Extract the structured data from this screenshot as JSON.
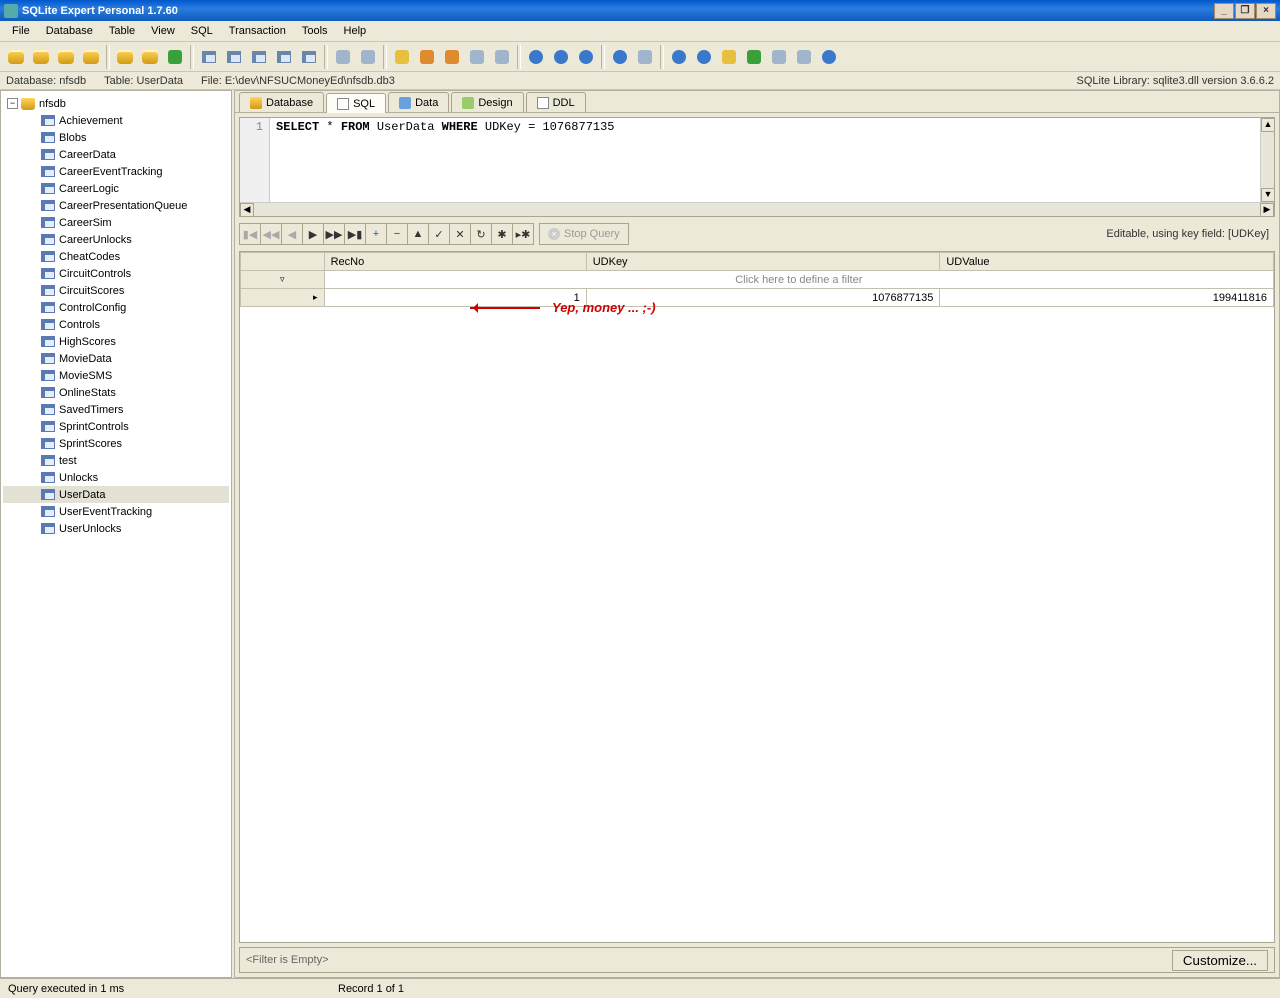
{
  "window": {
    "title": "SQLite Expert Personal 1.7.60"
  },
  "menu": {
    "file": "File",
    "database": "Database",
    "table": "Table",
    "view": "View",
    "sql": "SQL",
    "transaction": "Transaction",
    "tools": "Tools",
    "help": "Help"
  },
  "info": {
    "database_label": "Database: nfsdb",
    "table_label": "Table: UserData",
    "file_label": "File: E:\\dev\\NFSUCMoneyEd\\nfsdb.db3",
    "library": "SQLite Library: sqlite3.dll version 3.6.6.2"
  },
  "tree": {
    "root": "nfsdb",
    "items": [
      "Achievement",
      "Blobs",
      "CareerData",
      "CareerEventTracking",
      "CareerLogic",
      "CareerPresentationQueue",
      "CareerSim",
      "CareerUnlocks",
      "CheatCodes",
      "CircuitControls",
      "CircuitScores",
      "ControlConfig",
      "Controls",
      "HighScores",
      "MovieData",
      "MovieSMS",
      "OnlineStats",
      "SavedTimers",
      "SprintControls",
      "SprintScores",
      "test",
      "Unlocks",
      "UserData",
      "UserEventTracking",
      "UserUnlocks"
    ],
    "selected": "UserData"
  },
  "tabs": {
    "database": "Database",
    "sql": "SQL",
    "data": "Data",
    "design": "Design",
    "ddl": "DDL"
  },
  "sql": {
    "line_no": "1",
    "code_kw1": "SELECT",
    "code_mid": " * ",
    "code_kw2": "FROM",
    "code_tbl": " UserData ",
    "code_kw3": "WHERE",
    "code_rest": " UDKey = 1076877135"
  },
  "nav": {
    "stop_query": "Stop Query",
    "editable": "Editable, using key field: [UDKey]"
  },
  "grid": {
    "col_recno": "RecNo",
    "col_udkey": "UDKey",
    "col_udvalue": "UDValue",
    "filter_hint": "Click here to define a filter",
    "row": {
      "recno": "1",
      "udkey": "1076877135",
      "udvalue": "199411816"
    }
  },
  "annotation": "Yep, money ... ;-)",
  "filterbar": {
    "label": "<Filter is Empty>",
    "customize": "Customize..."
  },
  "status": {
    "exec": "Query executed in 1 ms",
    "record": "Record 1 of 1"
  }
}
